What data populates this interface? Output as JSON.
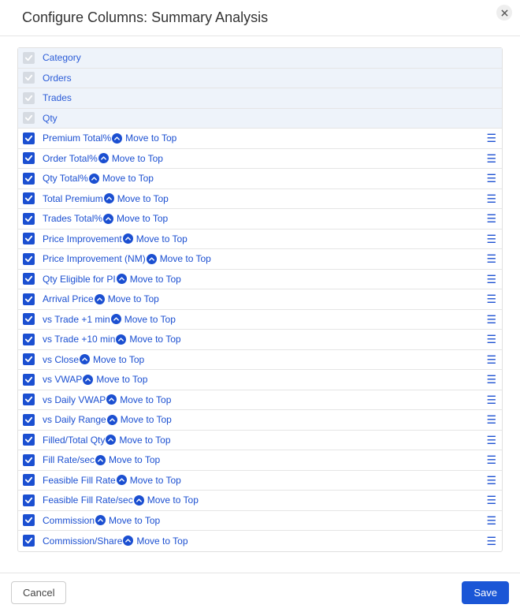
{
  "dialog": {
    "title": "Configure Columns: Summary Analysis",
    "moveToTopLabel": "Move to Top",
    "cancelLabel": "Cancel",
    "saveLabel": "Save"
  },
  "fixedColumns": [
    {
      "label": "Category"
    },
    {
      "label": "Orders"
    },
    {
      "label": "Trades"
    },
    {
      "label": "Qty"
    }
  ],
  "columns": [
    {
      "label": "Premium Total%"
    },
    {
      "label": "Order Total%"
    },
    {
      "label": "Qty Total%"
    },
    {
      "label": "Total Premium"
    },
    {
      "label": "Trades Total%"
    },
    {
      "label": "Price Improvement"
    },
    {
      "label": "Price Improvement (NM)"
    },
    {
      "label": "Qty Eligible for PI"
    },
    {
      "label": "Arrival Price"
    },
    {
      "label": "vs Trade +1 min"
    },
    {
      "label": "vs Trade +10 min"
    },
    {
      "label": "vs Close"
    },
    {
      "label": "vs VWAP"
    },
    {
      "label": "vs Daily VWAP"
    },
    {
      "label": "vs Daily Range"
    },
    {
      "label": "Filled/Total Qty"
    },
    {
      "label": "Fill Rate/sec"
    },
    {
      "label": "Feasible Fill Rate"
    },
    {
      "label": "Feasible Fill Rate/sec"
    },
    {
      "label": "Commission"
    },
    {
      "label": "Commission/Share"
    }
  ]
}
